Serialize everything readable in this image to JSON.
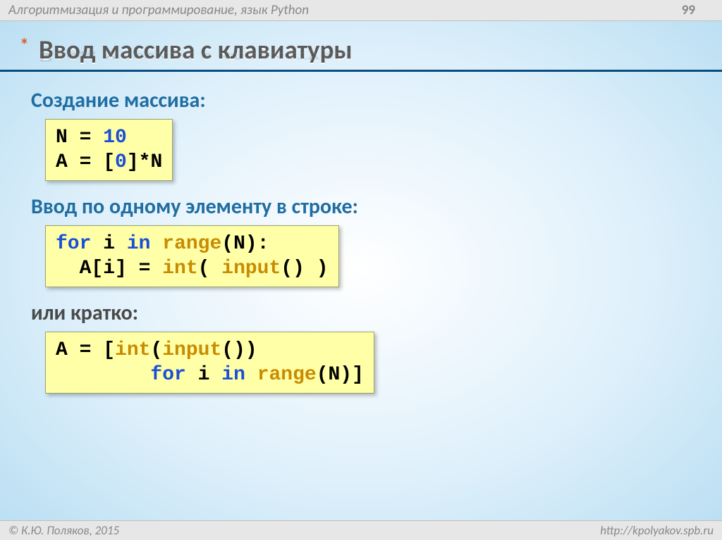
{
  "header": {
    "course": "Алгоритмизация и программирование, язык Python",
    "page": "99"
  },
  "title": {
    "asterisk": "*",
    "text": "Ввод массива с клавиатуры"
  },
  "sections": {
    "create_label": "Создание массива:",
    "input_label": "Ввод по одному элементу в строке:",
    "short_label": "или кратко:"
  },
  "code": {
    "block1": {
      "line1_lhs": "N",
      "line1_eq": " = ",
      "line1_val": "10",
      "line2_lhs": "A",
      "line2_eq": " = [",
      "line2_zero": "0",
      "line2_rest": "]*N"
    },
    "block2": {
      "kw_for": "for",
      "mid1": " i ",
      "kw_in": "in",
      "mid2": " ",
      "fn_range": "range",
      "tail1": "(N):",
      "indent": "  A[i] = ",
      "fn_int": "int",
      "paren_open": "( ",
      "fn_input": "input",
      "tail2": "() )"
    },
    "block3": {
      "lhs": "A = [",
      "fn_int": "int",
      "open": "(",
      "fn_input": "input",
      "close": "())",
      "indent": "        ",
      "kw_for": "for",
      "mid1": " i ",
      "kw_in": "in",
      "mid2": " ",
      "fn_range": "range",
      "tail": "(N)]"
    }
  },
  "footer": {
    "copyright": "© К.Ю. Поляков, 2015",
    "url": "http://kpolyakov.spb.ru"
  }
}
